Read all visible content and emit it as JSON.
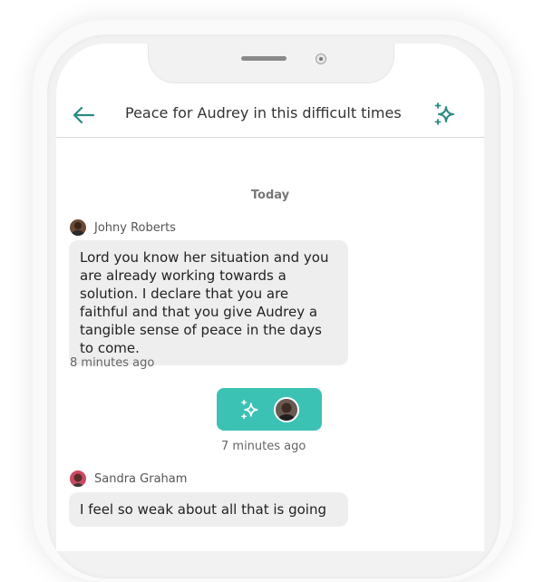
{
  "header": {
    "title": "Peace for Audrey in this difficult times",
    "back_icon": "arrow-left-icon",
    "action_icon": "sparkles-icon"
  },
  "chat": {
    "day_label": "Today",
    "messages": [
      {
        "author": "Johny Roberts",
        "text": "Lord you know her situation and you are already working towards a solution. I declare that you are faithful and that you give Audrey a tangible sense of peace in the days to come.",
        "time": "8 minutes ago"
      },
      {
        "author": "Sandra Graham",
        "text": "I feel so weak about all that is going"
      }
    ],
    "reaction": {
      "icon": "sparkles-icon",
      "time": "7 minutes ago"
    }
  },
  "colors": {
    "accent": "#3cc2b5",
    "icon": "#2a8a80",
    "bubble": "#eeeeee"
  }
}
